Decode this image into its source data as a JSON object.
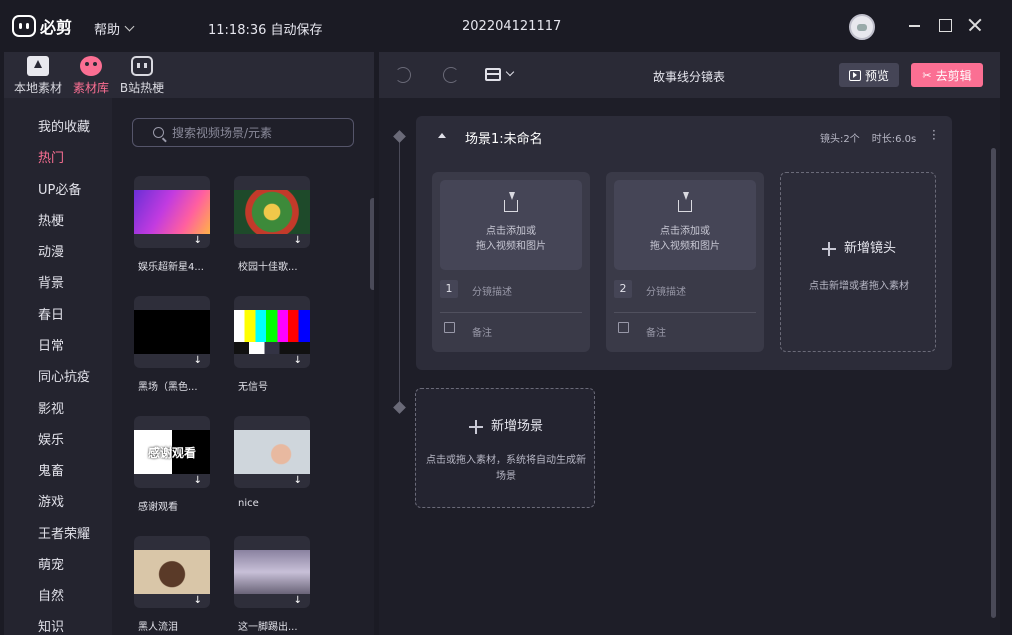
{
  "app": {
    "logo_text": "必剪",
    "help_label": "帮助",
    "autosave": "11:18:36 自动保存",
    "project_name": "202204121117"
  },
  "left_tabs": [
    {
      "label": "本地素材",
      "icon": "upload-folder-icon"
    },
    {
      "label": "素材库",
      "icon": "material-library-icon",
      "active": true
    },
    {
      "label": "B站热梗",
      "icon": "bilibili-tv-icon"
    }
  ],
  "categories": [
    "我的收藏",
    "热门",
    "UP必备",
    "热梗",
    "动漫",
    "背景",
    "春日",
    "日常",
    "同心抗疫",
    "影视",
    "娱乐",
    "鬼畜",
    "游戏",
    "王者荣耀",
    "萌宠",
    "自然",
    "知识"
  ],
  "active_category_index": 1,
  "search": {
    "placeholder": "搜索视频场景/元素"
  },
  "media": [
    {
      "label": "娱乐超新星4..."
    },
    {
      "label": "校园十佳歌..."
    },
    {
      "label": "黑场（黑色..."
    },
    {
      "label": "无信号"
    },
    {
      "label": "感谢观看",
      "overlay": "感谢观看"
    },
    {
      "label": "nice"
    },
    {
      "label": "黑人流泪"
    },
    {
      "label": "这一脚踢出..."
    }
  ],
  "toolbar": {
    "title": "故事线分镜表",
    "preview_label": "预览",
    "edit_label": "去剪辑"
  },
  "scene": {
    "title": "场景1:未命名",
    "shots_meta": "镜头:2个",
    "duration_meta": "时长:6.0s",
    "shots": [
      {
        "number": "1",
        "drop_line1": "点击添加或",
        "drop_line2": "拖入视频和图片",
        "desc": "分镜描述",
        "note": "备注"
      },
      {
        "number": "2",
        "drop_line1": "点击添加或",
        "drop_line2": "拖入视频和图片",
        "desc": "分镜描述",
        "note": "备注"
      }
    ],
    "add_shot_title": "新增镜头",
    "add_shot_sub": "点击新增或者拖入素材"
  },
  "add_scene": {
    "title": "新增场景",
    "sub": "点击或拖入素材，系统将自动生成新场景"
  },
  "colors": {
    "accent": "#fb6f93",
    "background": "#1b1b24",
    "panel": "#24242f"
  }
}
